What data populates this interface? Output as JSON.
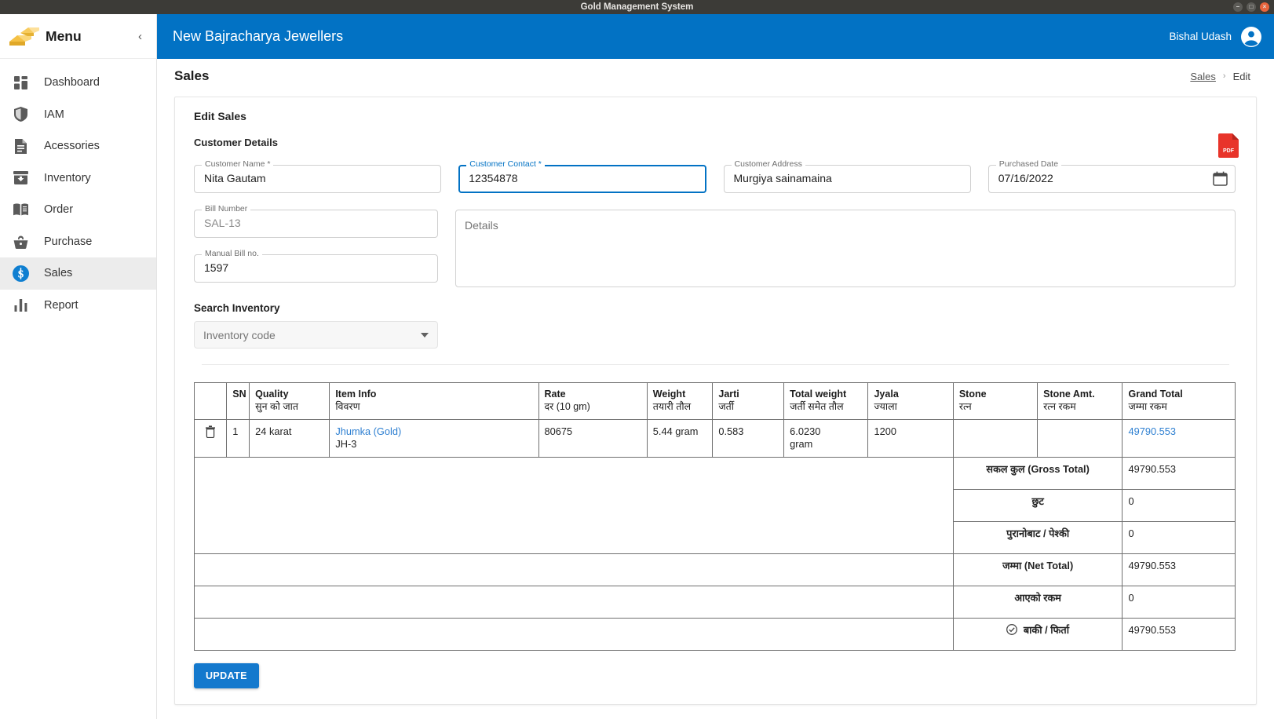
{
  "window": {
    "title": "Gold Management System",
    "controls": {
      "minimize": "–",
      "maximize": "□",
      "close": "×"
    }
  },
  "sidebar": {
    "brand_title": "Menu",
    "collapse_label": "‹",
    "logo_icon": "gold-bar-icon",
    "items": [
      {
        "label": "Dashboard",
        "icon": "dashboard-grid-icon",
        "active": false
      },
      {
        "label": "IAM",
        "icon": "shield-icon",
        "active": false
      },
      {
        "label": "Acessories",
        "icon": "document-icon",
        "active": false
      },
      {
        "label": "Inventory",
        "icon": "inbox-icon",
        "active": false
      },
      {
        "label": "Order",
        "icon": "book-icon",
        "active": false
      },
      {
        "label": "Purchase",
        "icon": "basket-icon",
        "active": false
      },
      {
        "label": "Sales",
        "icon": "dollar-circle-icon",
        "active": true
      },
      {
        "label": "Report",
        "icon": "bar-chart-icon",
        "active": false
      }
    ]
  },
  "topbar": {
    "company": "New Bajracharya Jewellers",
    "user": "Bishal Udash",
    "avatar_icon": "account-circle-icon",
    "accent": "#0272c4"
  },
  "page": {
    "title": "Sales",
    "breadcrumb": {
      "parent": "Sales",
      "separator": "›",
      "current": "Edit"
    }
  },
  "form": {
    "heading": "Edit Sales",
    "customer_section": "Customer Details",
    "pdf_icon": "pdf-file-icon",
    "pdf_badge": "PDF",
    "fields": {
      "customer_name": {
        "label": "Customer Name *",
        "value": "Nita Gautam"
      },
      "customer_contact": {
        "label": "Customer Contact *",
        "value": "12354878",
        "focused": true
      },
      "customer_address": {
        "label": "Customer Address",
        "value": "Murgiya sainamaina"
      },
      "purchased_date": {
        "label": "Purchased Date",
        "value": "07/16/2022",
        "icon": "calendar-icon"
      },
      "bill_number": {
        "label": "Bill Number",
        "value": "SAL-13",
        "disabled": true
      },
      "manual_bill_no": {
        "label": "Manual Bill no.",
        "value": "1597"
      },
      "details": {
        "placeholder": "Details",
        "value": ""
      }
    },
    "search_inventory": {
      "label": "Search Inventory",
      "placeholder": "Inventory code",
      "caret_icon": "chevron-down-icon"
    },
    "update_button": "UPDATE"
  },
  "table": {
    "delete_icon": "trash-icon",
    "columns": [
      {
        "en": "",
        "np": ""
      },
      {
        "en": "SN",
        "np": ""
      },
      {
        "en": "Quality",
        "np": "सुन को जात"
      },
      {
        "en": "Item Info",
        "np": "विवरण"
      },
      {
        "en": "Rate",
        "np": "दर (10 gm)"
      },
      {
        "en": "Weight",
        "np": "तयारी तौल"
      },
      {
        "en": "Jarti",
        "np": "जर्ती"
      },
      {
        "en": "Total weight",
        "np": "जर्ती समेत तौल"
      },
      {
        "en": "Jyala",
        "np": "ज्याला"
      },
      {
        "en": "Stone",
        "np": "रत्न"
      },
      {
        "en": "Stone Amt.",
        "np": "रत्न रकम"
      },
      {
        "en": "Grand Total",
        "np": "जम्मा रकम"
      }
    ],
    "rows": [
      {
        "sn": "1",
        "quality": "24 karat",
        "item_name": "Jhumka (Gold)",
        "item_code": "JH-3",
        "rate": "80675",
        "weight": "5.44 gram",
        "jarti": "0.583",
        "total_weight": "6.0230\ngram",
        "total_weight_a": "6.0230",
        "total_weight_b": "gram",
        "jyala": "1200",
        "stone": "",
        "stone_amt": "",
        "grand_total": "49790.553"
      }
    ],
    "totals": [
      {
        "label": "सकल कुल (Gross Total)",
        "value": "49790.553",
        "icon": ""
      },
      {
        "label": "छुट",
        "value": "0",
        "icon": ""
      },
      {
        "label": "पुरानोबाट / पेश्की",
        "value": "0",
        "icon": ""
      },
      {
        "label": "जम्मा (Net Total)",
        "value": "49790.553",
        "icon": ""
      },
      {
        "label": "आएको रकम",
        "value": "0",
        "icon": ""
      },
      {
        "label": "बाकी / फिर्ता",
        "value": "49790.553",
        "icon": "check-circle-icon"
      }
    ]
  }
}
